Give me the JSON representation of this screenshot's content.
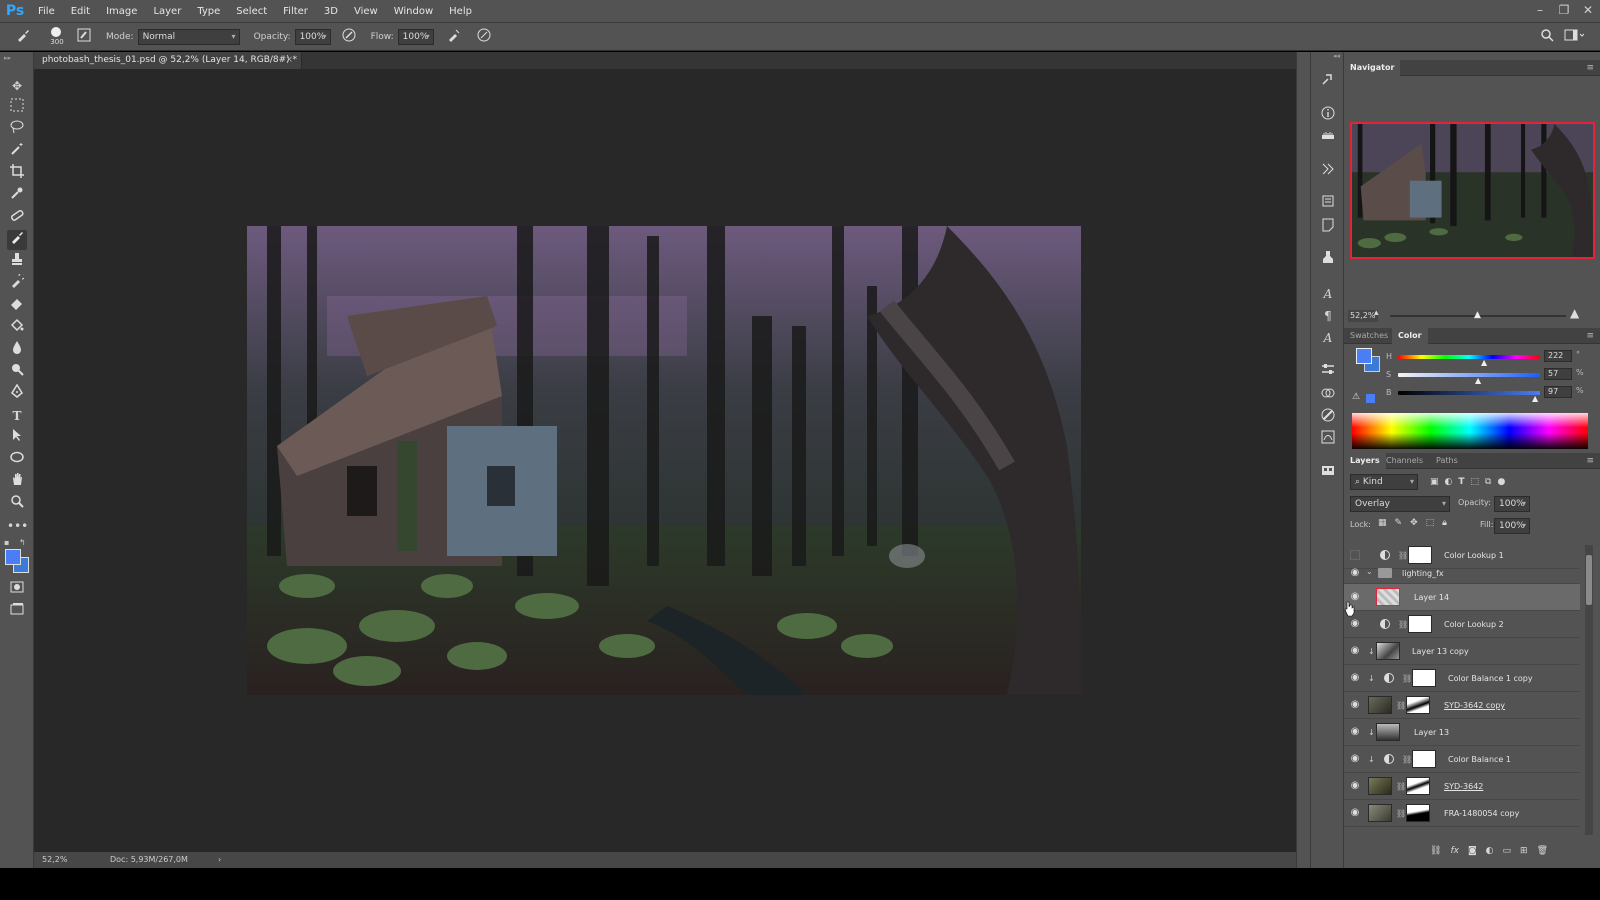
{
  "app": {
    "logo": "Ps"
  },
  "menu": [
    "File",
    "Edit",
    "Image",
    "Layer",
    "Type",
    "Select",
    "Filter",
    "3D",
    "View",
    "Window",
    "Help"
  ],
  "window_controls": {
    "minimize": "–",
    "restore": "❐",
    "close": "✕"
  },
  "options_bar": {
    "brush_size": "300",
    "mode_label": "Mode:",
    "mode_value": "Normal",
    "opacity_label": "Opacity:",
    "opacity_value": "100%",
    "flow_label": "Flow:",
    "flow_value": "100%"
  },
  "document": {
    "tab_title": "photobash_thesis_01.psd @ 52,2% (Layer 14, RGB/8#) *",
    "close": "×"
  },
  "status": {
    "zoom": "52,2%",
    "doc": "Doc: 5,93M/267,0M",
    "arrow": "›"
  },
  "navigator": {
    "title": "Navigator",
    "zoom": "52,2%"
  },
  "color_panel": {
    "tabs": [
      "Swatches",
      "Color"
    ],
    "active_tab": "Color",
    "h_label": "H",
    "h_value": "222",
    "h_unit": "°",
    "s_label": "S",
    "s_value": "57",
    "s_unit": "%",
    "b_label": "B",
    "b_value": "97",
    "b_unit": "%",
    "foreground": "#4a7ef5",
    "background": "#3b7bd6"
  },
  "layers_panel": {
    "tabs": [
      "Layers",
      "Channels",
      "Paths"
    ],
    "active_tab": "Layers",
    "filter_label": "Kind",
    "blend_mode": "Overlay",
    "opacity_label": "Opacity:",
    "opacity_value": "100%",
    "lock_label": "Lock:",
    "fill_label": "Fill:",
    "fill_value": "100%",
    "layers": [
      {
        "name": "Color Lookup 1",
        "visible": false,
        "type": "adjustment"
      },
      {
        "name": "lighting_fx",
        "visible": true,
        "type": "group"
      },
      {
        "name": "Layer 14",
        "visible": true,
        "type": "pixel",
        "selected": true
      },
      {
        "name": "Color Lookup 2",
        "visible": true,
        "type": "adjustment"
      },
      {
        "name": "Layer 13 copy",
        "visible": true,
        "type": "pixel"
      },
      {
        "name": "Color Balance 1 copy",
        "visible": true,
        "type": "adjustment"
      },
      {
        "name": "SYD-3642 copy",
        "visible": true,
        "type": "masked"
      },
      {
        "name": "Layer 13",
        "visible": true,
        "type": "pixel"
      },
      {
        "name": "Color Balance 1",
        "visible": true,
        "type": "adjustment"
      },
      {
        "name": "SYD-3642",
        "visible": true,
        "type": "masked"
      },
      {
        "name": "FRA-1480054 copy",
        "visible": true,
        "type": "masked"
      }
    ]
  }
}
